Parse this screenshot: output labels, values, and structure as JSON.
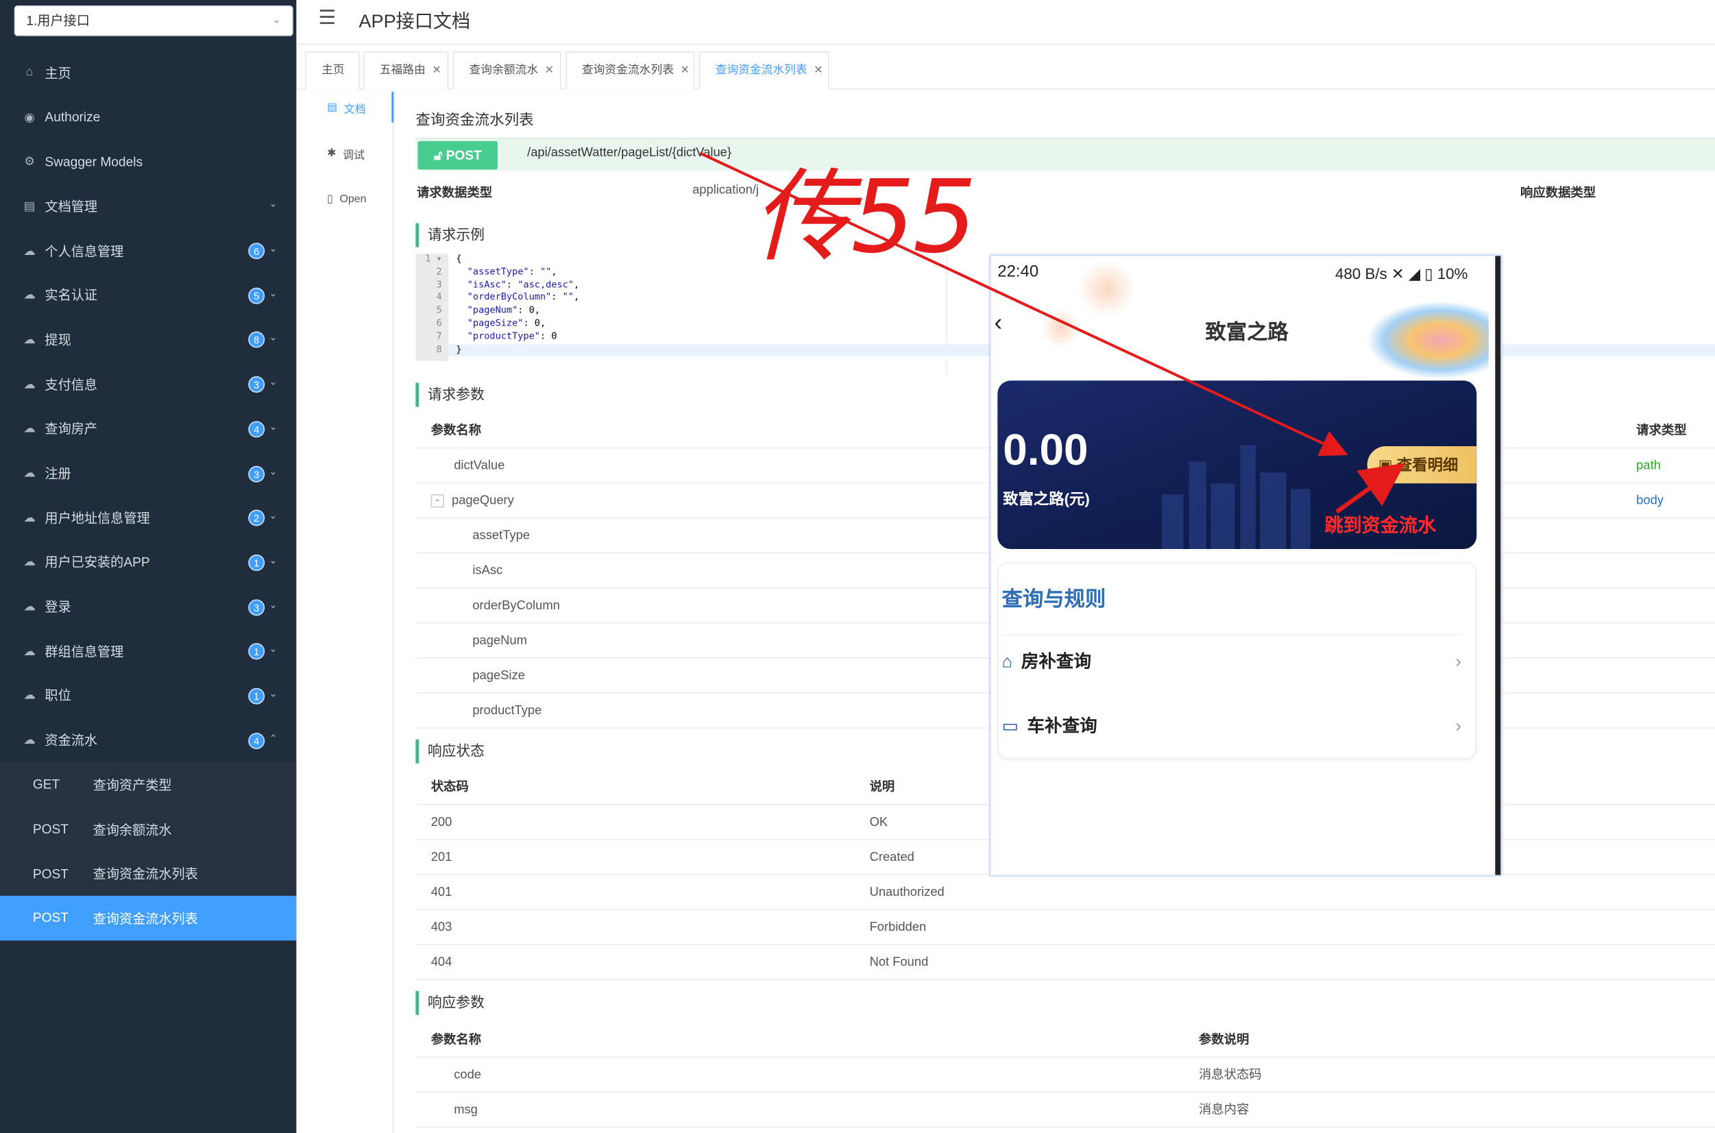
{
  "sidebar": {
    "group_select": "1.用户接口",
    "menu": [
      {
        "icon": "home-icon",
        "label": "主页",
        "badge": null,
        "arrow": ""
      },
      {
        "icon": "authorize-icon",
        "label": "Authorize",
        "badge": null,
        "arrow": ""
      },
      {
        "icon": "models-icon",
        "label": "Swagger Models",
        "badge": null,
        "arrow": ""
      },
      {
        "icon": "docs-icon",
        "label": "文档管理",
        "badge": null,
        "arrow": "⌄"
      },
      {
        "icon": "cloud-icon",
        "label": "个人信息管理",
        "badge": "6",
        "arrow": "⌄"
      },
      {
        "icon": "cloud-icon",
        "label": "实名认证",
        "badge": "5",
        "arrow": "⌄"
      },
      {
        "icon": "cloud-icon",
        "label": "提现",
        "badge": "8",
        "arrow": "⌄"
      },
      {
        "icon": "cloud-icon",
        "label": "支付信息",
        "badge": "3",
        "arrow": "⌄"
      },
      {
        "icon": "cloud-icon",
        "label": "查询房产",
        "badge": "4",
        "arrow": "⌄"
      },
      {
        "icon": "cloud-icon",
        "label": "注册",
        "badge": "3",
        "arrow": "⌄"
      },
      {
        "icon": "cloud-icon",
        "label": "用户地址信息管理",
        "badge": "2",
        "arrow": "⌄"
      },
      {
        "icon": "cloud-icon",
        "label": "用户已安装的APP",
        "badge": "1",
        "arrow": "⌄"
      },
      {
        "icon": "cloud-icon",
        "label": "登录",
        "badge": "3",
        "arrow": "⌄"
      },
      {
        "icon": "cloud-icon",
        "label": "群组信息管理",
        "badge": "1",
        "arrow": "⌄"
      },
      {
        "icon": "cloud-icon",
        "label": "职位",
        "badge": "1",
        "arrow": "⌄"
      },
      {
        "icon": "cloud-icon",
        "label": "资金流水",
        "badge": "4",
        "arrow": "⌃"
      }
    ],
    "submenu": [
      {
        "method": "GET",
        "label": "查询资产类型",
        "active": false
      },
      {
        "method": "POST",
        "label": "查询余额流水",
        "active": false
      },
      {
        "method": "POST",
        "label": "查询资金流水列表",
        "active": false
      },
      {
        "method": "POST",
        "label": "查询资金流水列表",
        "active": true
      }
    ]
  },
  "header": {
    "title": "APP接口文档"
  },
  "tabs": [
    {
      "label": "主页",
      "closable": false
    },
    {
      "label": "五福路由",
      "closable": true
    },
    {
      "label": "查询余额流水",
      "closable": true
    },
    {
      "label": "查询资金流水列表",
      "closable": true
    },
    {
      "label": "查询资金流水列表",
      "closable": true,
      "active": true
    }
  ],
  "rail": {
    "doc": "文档",
    "debug": "调试",
    "open": "Open"
  },
  "doc": {
    "title": "查询资金流水列表",
    "method": "POST",
    "path": "/api/assetWatter/pageList/{dictValue}",
    "req_type_label": "请求数据类型",
    "req_type_value": "application/j",
    "resp_type_label": "响应数据类型",
    "example_title": "请求示例",
    "example_lines": [
      "{",
      "  \"assetType\": \"\",",
      "  \"isAsc\": \"asc,desc\",",
      "  \"orderByColumn\": \"\",",
      "  \"pageNum\": 0,",
      "  \"pageSize\": 0,",
      "  \"productType\": 0",
      "}"
    ],
    "params_title": "请求参数",
    "params_head": {
      "name": "参数名称",
      "type": "请求类型"
    },
    "params": [
      {
        "name": "dictValue",
        "indent": 1,
        "type": "path",
        "toggle": false
      },
      {
        "name": "pageQuery",
        "indent": 1,
        "type": "body",
        "toggle": true
      },
      {
        "name": "assetType",
        "indent": 2,
        "type": "",
        "toggle": false
      },
      {
        "name": "isAsc",
        "indent": 2,
        "type": "",
        "toggle": false
      },
      {
        "name": "orderByColumn",
        "indent": 2,
        "type": "",
        "toggle": false
      },
      {
        "name": "pageNum",
        "indent": 2,
        "type": "",
        "toggle": false
      },
      {
        "name": "pageSize",
        "indent": 2,
        "type": "",
        "toggle": false
      },
      {
        "name": "productType",
        "indent": 2,
        "type": "",
        "toggle": false
      }
    ],
    "status_title": "响应状态",
    "status_head": {
      "code": "状态码",
      "desc": "说明"
    },
    "status": [
      {
        "code": "200",
        "desc": "OK"
      },
      {
        "code": "201",
        "desc": "Created"
      },
      {
        "code": "401",
        "desc": "Unauthorized"
      },
      {
        "code": "403",
        "desc": "Forbidden"
      },
      {
        "code": "404",
        "desc": "Not Found"
      }
    ],
    "resp_title": "响应参数",
    "resp_head": {
      "name": "参数名称",
      "desc": "参数说明"
    },
    "resp": [
      {
        "name": "code",
        "desc": "消息状态码"
      },
      {
        "name": "msg",
        "desc": "消息内容"
      }
    ]
  },
  "phone": {
    "time": "22:40",
    "status_right": "480 B/s  ✕  ◢  ▯ 10%",
    "title": "致富之路",
    "amount": "0.00",
    "amount_label": "致富之路(元)",
    "detail_button": "查看明细",
    "jump_note": "跳到资金流水",
    "section_title": "查询与规则",
    "items": [
      "房补查询",
      "车补查询"
    ]
  },
  "annotation": {
    "text": "传55",
    "color": "#e41b1b"
  }
}
